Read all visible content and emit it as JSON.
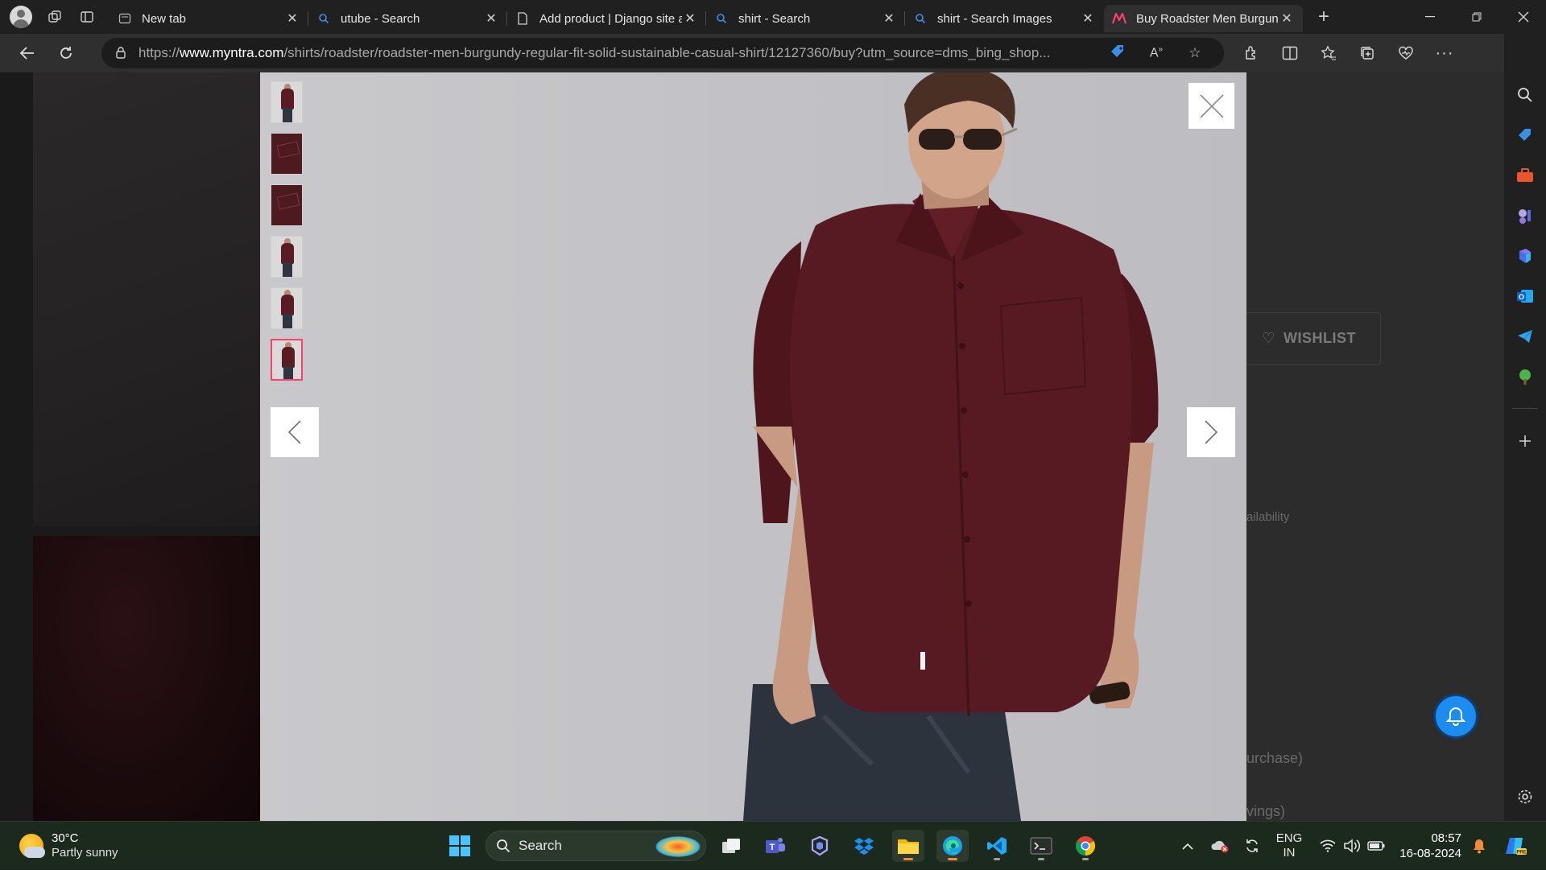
{
  "browser": {
    "tabs": [
      {
        "title": "New tab",
        "icon": "new-tab-page-icon",
        "active": false
      },
      {
        "title": "utube - Search",
        "icon": "search-icon",
        "active": false
      },
      {
        "title": "Add product | Django site admin",
        "icon": "page-icon",
        "active": false
      },
      {
        "title": "shirt - Search",
        "icon": "search-icon",
        "active": false
      },
      {
        "title": "shirt - Search Images",
        "icon": "search-icon",
        "active": false
      },
      {
        "title": "Buy Roadster Men Burgundy Regular Fit Solid Sustainable Casual Shirt",
        "icon": "myntra-icon",
        "active": true
      }
    ],
    "url_prefix": "https://",
    "url_domain": "www.myntra.com",
    "url_rest": "/shirts/roadster/roadster-men-burgundy-regular-fit-solid-sustainable-casual-shirt/12127360/buy?utm_source=dms_bing_shop..."
  },
  "page": {
    "wishlist_label": "WISHLIST",
    "ghost_availability": "ailability",
    "ghost_purchase": "urchase)",
    "ghost_savings": "vings)"
  },
  "viewer": {
    "thumbnails": [
      {
        "kind": "model",
        "selected": false
      },
      {
        "kind": "fabric",
        "selected": false
      },
      {
        "kind": "fabric",
        "selected": false
      },
      {
        "kind": "model",
        "selected": false
      },
      {
        "kind": "model",
        "selected": false
      },
      {
        "kind": "model",
        "selected": true
      }
    ],
    "shirt_color": "#5a1c22",
    "accent_color": "#ff3f6c"
  },
  "taskbar": {
    "weather_temp": "30°C",
    "weather_cond": "Partly sunny",
    "search_label": "Search",
    "lang_top": "ENG",
    "lang_bottom": "IN",
    "time": "08:57",
    "date": "16-08-2024"
  }
}
